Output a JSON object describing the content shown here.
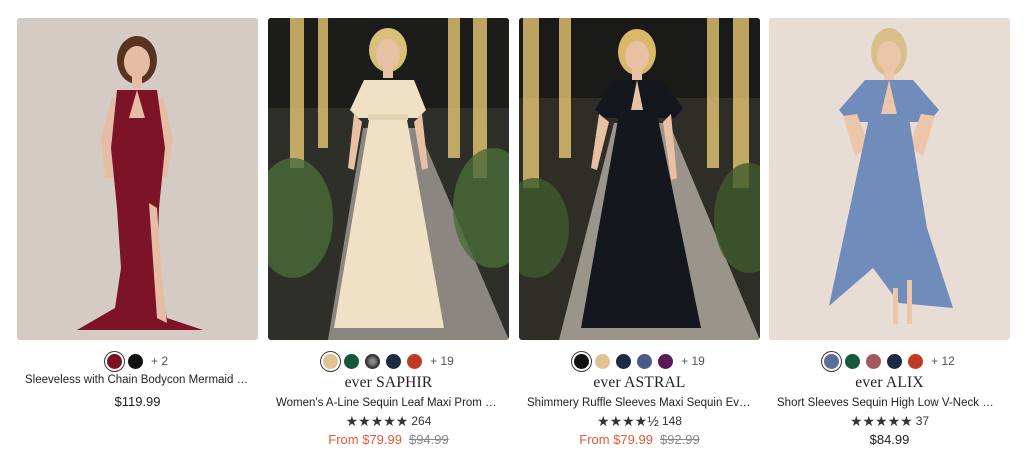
{
  "products": [
    {
      "brand": "",
      "title": "Sleeveless with Chain Bodycon Mermaid High Sl...",
      "swatches": [
        "#7a1224",
        "#111111"
      ],
      "more_colors": "+ 2",
      "rating_stars": "",
      "review_count": "",
      "price_from": "",
      "price_original": "",
      "price": "$119.99",
      "photo": {
        "bg": "#d8cfc8",
        "dress": "#7d1326",
        "skin": "#e6bca4",
        "hair": "#5a3222"
      }
    },
    {
      "brand": "ever SAPHIR",
      "title": "Women's A-Line Sequin Leaf Maxi Prom Dress...",
      "swatches": [
        "#e2c292",
        "#135a3a",
        "#4a4a4a",
        "#1d2a45",
        "#c23a24"
      ],
      "more_colors": "+ 19",
      "rating_stars": "★★★★★",
      "review_count": "264",
      "price_from": "From $79.99",
      "price_original": "$94.99",
      "price": "",
      "photo": {
        "bg": "#3a3b32",
        "dress": "#f0e1c6",
        "skin": "#e8c0a4",
        "hair": "#d9c07a"
      }
    },
    {
      "brand": "ever ASTRAL",
      "title": "Shimmery Ruffle Sleeves Maxi Sequin Evening...",
      "swatches": [
        "#111111",
        "#e2c292",
        "#1d2a45",
        "#4a5a8a",
        "#5a1a5a"
      ],
      "more_colors": "+ 19",
      "rating_stars": "★★★★½",
      "review_count": "148",
      "price_from": "From $79.99",
      "price_original": "$92.99",
      "price": "",
      "photo": {
        "bg": "#3a3a30",
        "dress": "#15171e",
        "skin": "#e8c0a4",
        "hair": "#d9b86a"
      }
    },
    {
      "brand": "ever ALIX",
      "title": "Short Sleeves Sequin High Low V-Neck Midi...",
      "swatches": [
        "#5a6f98",
        "#135a3a",
        "#a2585e",
        "#1d2a45",
        "#c23a24"
      ],
      "more_colors": "+ 12",
      "rating_stars": "★★★★★",
      "review_count": "37",
      "price_from": "",
      "price_original": "",
      "price": "$84.99",
      "photo": {
        "bg": "#e8ddd5",
        "dress": "#6f8cba",
        "skin": "#ecc6aa",
        "hair": "#d8bf8c"
      }
    }
  ]
}
